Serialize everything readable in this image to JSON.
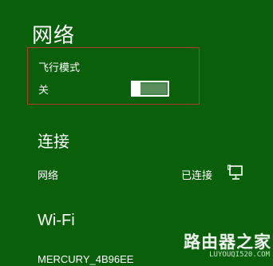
{
  "page": {
    "title": "网络"
  },
  "airplane": {
    "label": "飞行模式",
    "state": "关",
    "enabled": false
  },
  "connections": {
    "title": "连接",
    "items": [
      {
        "name": "网络",
        "status": "已连接",
        "icon": "ethernet-icon"
      }
    ]
  },
  "wifi": {
    "title": "Wi-Fi",
    "networks": [
      {
        "name": "MERCURY_4B96EE"
      }
    ]
  },
  "watermark": {
    "title": "路由器之家",
    "url": "LUYOUQI520.COM"
  },
  "colors": {
    "background": "#0a5f0a",
    "highlight_border": "#b33a2e",
    "text": "#ffffff"
  }
}
